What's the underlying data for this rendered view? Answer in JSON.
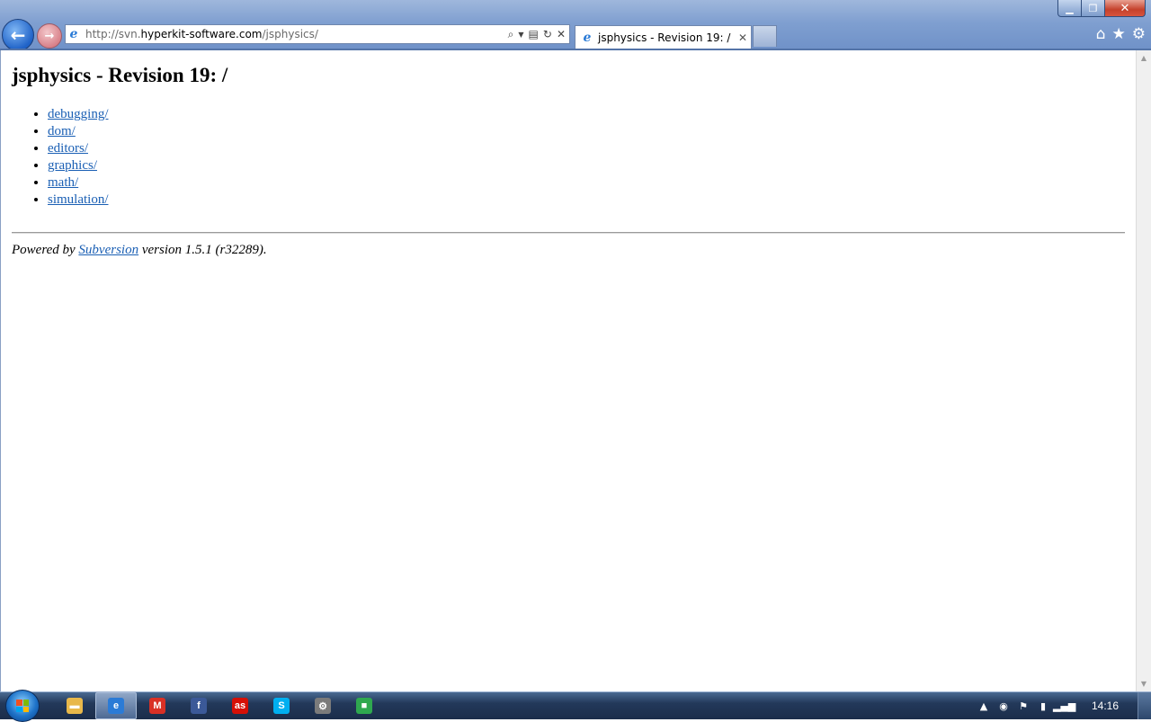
{
  "browser": {
    "url_prefix": "http://svn.",
    "url_host": "hyperkit-software.com",
    "url_path": "/jsphysics/",
    "tab_title": "jsphysics - Revision 19: /",
    "icons": {
      "back": "back-arrow-icon",
      "forward": "forward-arrow-icon",
      "page": "ie-page-icon",
      "search": "search-icon",
      "dropdown": "chevron-down-icon",
      "compat": "compatibility-view-icon",
      "refresh": "refresh-icon",
      "stop": "stop-icon",
      "close_tab": "close-icon",
      "home": "home-icon",
      "favorites": "star-icon",
      "tools": "gear-icon"
    },
    "window_controls": {
      "minimize": "minimize-icon",
      "maximize": "restore-icon",
      "close": "close-icon"
    }
  },
  "page": {
    "heading": "jsphysics - Revision 19: /",
    "items": [
      "debugging/",
      "dom/",
      "editors/",
      "graphics/",
      "math/",
      "simulation/"
    ],
    "footer": {
      "prefix": "Powered by ",
      "link": "Subversion",
      "suffix": " version 1.5.1 (r32289)."
    },
    "link_color": "#1a5fb4"
  },
  "taskbar": {
    "apps": [
      {
        "name": "file-explorer-icon",
        "glyph": "▬",
        "color": "#e8b84a",
        "active": false
      },
      {
        "name": "internet-explorer-icon",
        "glyph": "e",
        "color": "#2b7bd6",
        "active": true
      },
      {
        "name": "gmail-icon",
        "glyph": "M",
        "color": "#d93025",
        "active": false
      },
      {
        "name": "facebook-icon",
        "glyph": "f",
        "color": "#3b5998",
        "active": false
      },
      {
        "name": "lastfm-icon",
        "glyph": "as",
        "color": "#d51007",
        "active": false
      },
      {
        "name": "skype-icon",
        "glyph": "S",
        "color": "#00aff0",
        "active": false
      },
      {
        "name": "network-tool-icon",
        "glyph": "⚙",
        "color": "#7b7b7b",
        "active": false
      },
      {
        "name": "utility-app-icon",
        "glyph": "■",
        "color": "#2fa84f",
        "active": false
      }
    ],
    "tray": [
      "show-hidden-icon",
      "media-icon",
      "action-center-flag-icon",
      "power-icon",
      "network-signal-icon"
    ],
    "clock": "14:16"
  }
}
